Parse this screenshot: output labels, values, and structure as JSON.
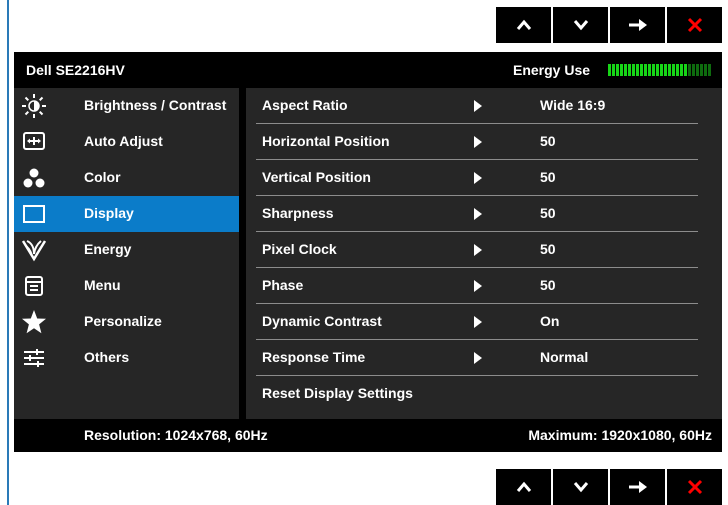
{
  "nav_buttons": {
    "up_icon": "up-chevron-icon",
    "down_icon": "down-chevron-icon",
    "enter_icon": "right-arrow-icon",
    "exit_icon": "close-x-icon"
  },
  "osd": {
    "model": "Dell SE2216HV",
    "energy_label": "Energy Use",
    "energy_level": 0.78,
    "colors": {
      "accent": "#0b7cc9",
      "energy_on": "#17d517",
      "energy_off": "#0e6b0e",
      "exit": "#ff0000",
      "panel": "#262626"
    }
  },
  "menu": {
    "items": [
      {
        "label": "Brightness / Contrast",
        "icon": "brightness-sun-icon"
      },
      {
        "label": "Auto Adjust",
        "icon": "auto-adjust-icon"
      },
      {
        "label": "Color",
        "icon": "color-dots-icon"
      },
      {
        "label": "Display",
        "icon": "display-monitor-icon"
      },
      {
        "label": "Energy",
        "icon": "energy-leaf-icon"
      },
      {
        "label": "Menu",
        "icon": "menu-list-icon"
      },
      {
        "label": "Personalize",
        "icon": "star-icon"
      },
      {
        "label": "Others",
        "icon": "sliders-icon"
      }
    ],
    "active_index": 3
  },
  "settings": {
    "rows": [
      {
        "name": "Aspect Ratio",
        "value": "Wide 16:9"
      },
      {
        "name": "Horizontal Position",
        "value": "50"
      },
      {
        "name": "Vertical Position",
        "value": "50"
      },
      {
        "name": "Sharpness",
        "value": "50"
      },
      {
        "name": "Pixel Clock",
        "value": "50"
      },
      {
        "name": "Phase",
        "value": "50"
      },
      {
        "name": "Dynamic Contrast",
        "value": "On"
      },
      {
        "name": "Response Time",
        "value": "Normal"
      }
    ],
    "reset_label": "Reset Display Settings"
  },
  "footer": {
    "resolution": "Resolution: 1024x768, 60Hz",
    "maximum": "Maximum: 1920x1080, 60Hz"
  }
}
